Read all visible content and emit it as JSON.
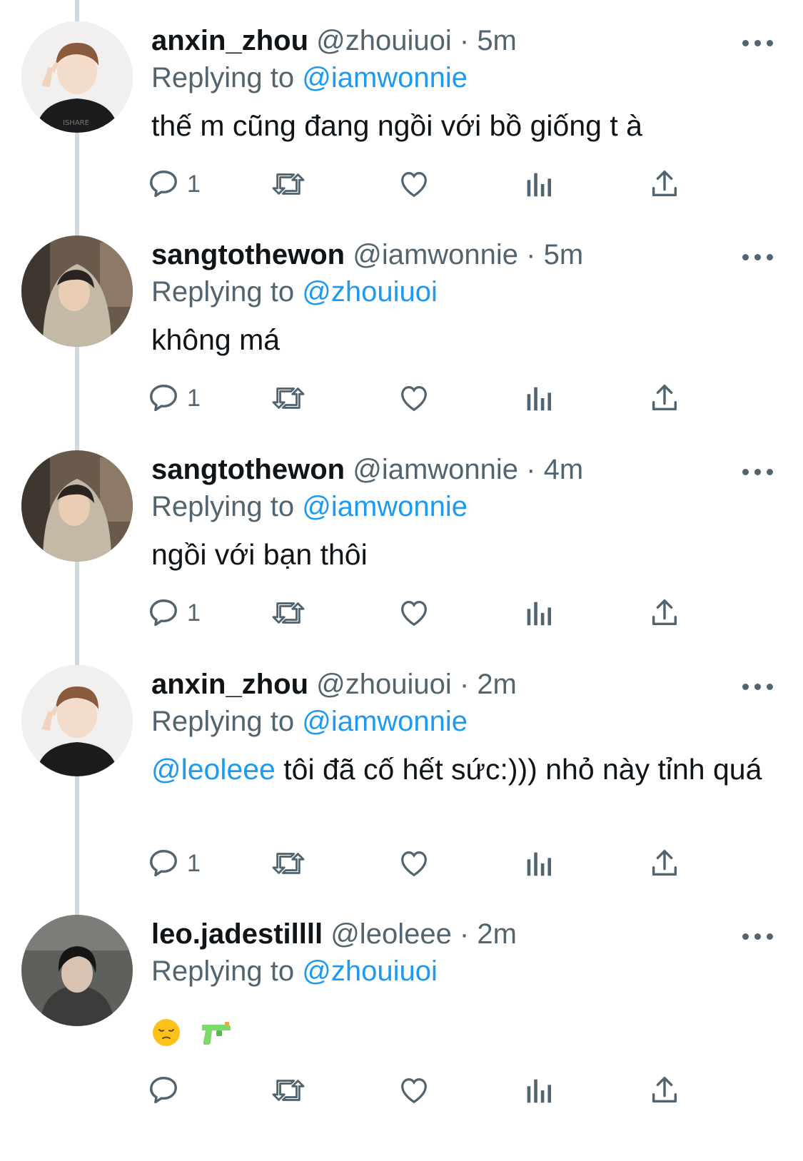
{
  "tweets": [
    {
      "name": "anxin_zhou",
      "handle": "@zhouiuoi",
      "sep": " · ",
      "time": "5m",
      "replying_prefix": "Replying to ",
      "replying_to": "@iamwonnie",
      "text": "thế m cũng đang ngồi với bồ giống t à",
      "reply_count": "1",
      "avatar": "avatar-anxin"
    },
    {
      "name": "sangtothewon",
      "handle": "@iamwonnie",
      "sep": " · ",
      "time": "5m",
      "replying_prefix": "Replying to ",
      "replying_to": "@zhouiuoi",
      "text": "không má",
      "reply_count": "1",
      "avatar": "avatar-sang"
    },
    {
      "name": "sangtothewon",
      "handle": "@iamwonnie",
      "sep": " · ",
      "time": "4m",
      "replying_prefix": "Replying to ",
      "replying_to": "@iamwonnie",
      "text": "ngồi với bạn thôi",
      "reply_count": "1",
      "avatar": "avatar-sang"
    },
    {
      "name": "anxin_zhou",
      "handle": "@zhouiuoi",
      "sep": " · ",
      "time": "2m",
      "replying_prefix": "Replying to ",
      "replying_to": "@iamwonnie",
      "mention": "@leoleee",
      "text": " tôi đã cố hết sức:))) nhỏ này tỉnh quá",
      "reply_count": "1",
      "avatar": "avatar-anxin"
    },
    {
      "name": "leo.jadestillll",
      "handle": "@leoleee",
      "sep": " · ",
      "time": "2m",
      "replying_prefix": "Replying to ",
      "replying_to": "@zhouiuoi",
      "emojis": [
        "pensive-face",
        "water-pistol"
      ],
      "reply_count": "",
      "avatar": "avatar-leo"
    }
  ],
  "icons": {
    "reply": "reply-icon",
    "retweet": "retweet-icon",
    "like": "heart-icon",
    "views": "analytics-icon",
    "share": "share-icon",
    "more": "more-icon"
  },
  "colors": {
    "link": "#1d9bf0",
    "secondary": "#536471",
    "thread_line": "#cfd9de"
  }
}
